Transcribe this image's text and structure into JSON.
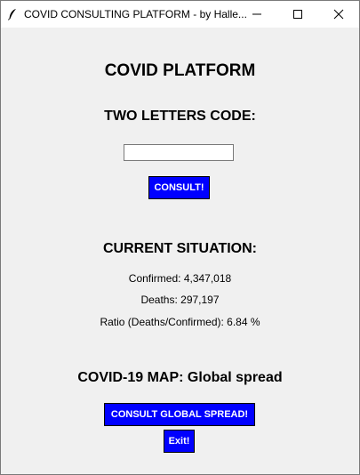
{
  "window": {
    "title": "COVID CONSULTING PLATFORM - by Halle...",
    "icons": {
      "app": "feather-icon",
      "minimize": "minimize-icon",
      "maximize": "maximize-icon",
      "close": "close-icon"
    }
  },
  "main": {
    "title": "COVID PLATFORM",
    "code_label": "TWO LETTERS CODE:",
    "code_input": {
      "value": "",
      "placeholder": ""
    },
    "consult_button": "CONSULT!",
    "situation_heading": "CURRENT SITUATION:",
    "confirmed": "Confirmed: 4,347,018",
    "deaths": "Deaths: 297,197",
    "ratio": "Ratio (Deaths/Confirmed): 6.84 %",
    "map_heading": "COVID-19 MAP: Global spread",
    "global_button": "CONSULT GLOBAL SPREAD!",
    "exit_button": "Exit!"
  },
  "colors": {
    "button_bg": "#0000ff",
    "button_text": "#ffffff",
    "window_bg": "#f0f0f0"
  }
}
